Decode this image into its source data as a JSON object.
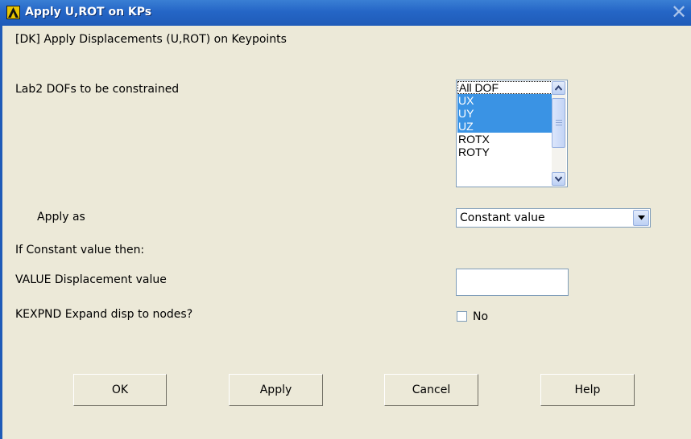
{
  "window": {
    "title": "Apply U,ROT on KPs",
    "close_glyph": "✕"
  },
  "form": {
    "heading": "[DK]  Apply Displacements (U,ROT) on Keypoints",
    "lab2_label": "Lab2    DOFs to be constrained",
    "dof_list": [
      {
        "label": "All DOF",
        "selected": false
      },
      {
        "label": "UX",
        "selected": true
      },
      {
        "label": "UY",
        "selected": true
      },
      {
        "label": "UZ",
        "selected": true
      },
      {
        "label": "ROTX",
        "selected": false
      },
      {
        "label": "ROTY",
        "selected": false
      }
    ],
    "apply_as_label": "Apply as",
    "apply_as_value": "Constant value",
    "if_constant_label": "If Constant value then:",
    "value_label": "VALUE   Displacement value",
    "value_input": "",
    "kexpnd_label": "KEXPND  Expand disp to nodes?",
    "kexpnd_checked": false,
    "kexpnd_state": "No"
  },
  "buttons": {
    "ok": "OK",
    "apply": "Apply",
    "cancel": "Cancel",
    "help": "Help"
  },
  "colors": {
    "title_bar": "#2566c6",
    "selection": "#3a93e4",
    "dialog_bg": "#ece9d8"
  }
}
